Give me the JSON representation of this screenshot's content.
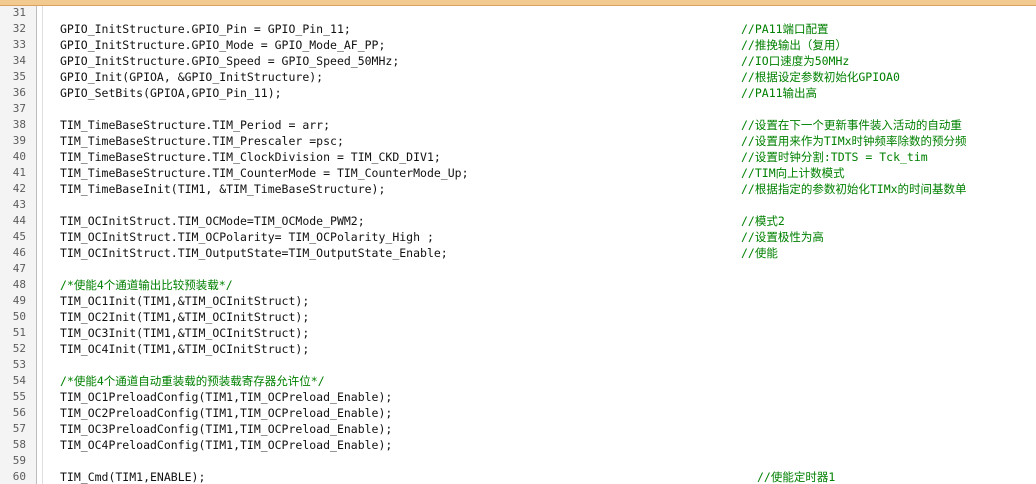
{
  "editor": {
    "lines": [
      {
        "num": "31",
        "code": "",
        "comment": ""
      },
      {
        "num": "32",
        "code": "GPIO_InitStructure.GPIO_Pin = GPIO_Pin_11;",
        "comment": "//PA11端口配置"
      },
      {
        "num": "33",
        "code": "GPIO_InitStructure.GPIO_Mode = GPIO_Mode_AF_PP;",
        "comment": "//推挽输出（复用）"
      },
      {
        "num": "34",
        "code": "GPIO_InitStructure.GPIO_Speed = GPIO_Speed_50MHz;",
        "comment": "//IO口速度为50MHz"
      },
      {
        "num": "35",
        "code": "GPIO_Init(GPIOA, &GPIO_InitStructure);",
        "comment": "//根据设定参数初始化GPIOA0"
      },
      {
        "num": "36",
        "code": "GPIO_SetBits(GPIOA,GPIO_Pin_11);",
        "comment": "//PA11输出高"
      },
      {
        "num": "37",
        "code": "",
        "comment": ""
      },
      {
        "num": "38",
        "code": "TIM_TimeBaseStructure.TIM_Period = arr;",
        "comment": "//设置在下一个更新事件装入活动的自动重"
      },
      {
        "num": "39",
        "code": "TIM_TimeBaseStructure.TIM_Prescaler =psc;",
        "comment": "//设置用来作为TIMx时钟频率除数的预分频"
      },
      {
        "num": "40",
        "code": "TIM_TimeBaseStructure.TIM_ClockDivision = TIM_CKD_DIV1;",
        "comment": "//设置时钟分割:TDTS = Tck_tim"
      },
      {
        "num": "41",
        "code": "TIM_TimeBaseStructure.TIM_CounterMode = TIM_CounterMode_Up;",
        "comment": "//TIM向上计数模式"
      },
      {
        "num": "42",
        "code": "TIM_TimeBaseInit(TIM1, &TIM_TimeBaseStructure);",
        "comment": "//根据指定的参数初始化TIMx的时间基数单"
      },
      {
        "num": "43",
        "code": "",
        "comment": ""
      },
      {
        "num": "44",
        "code": "TIM_OCInitStruct.TIM_OCMode=TIM_OCMode_PWM2;",
        "comment": "//模式2"
      },
      {
        "num": "45",
        "code": "TIM_OCInitStruct.TIM_OCPolarity= TIM_OCPolarity_High ;",
        "comment": "//设置极性为高"
      },
      {
        "num": "46",
        "code": "TIM_OCInitStruct.TIM_OutputState=TIM_OutputState_Enable;",
        "comment": "//使能"
      },
      {
        "num": "47",
        "code": "",
        "comment": ""
      },
      {
        "num": "48",
        "code": "/*使能4个通道输出比较预装载*/",
        "comment": ""
      },
      {
        "num": "49",
        "code": "TIM_OC1Init(TIM1,&TIM_OCInitStruct);",
        "comment": ""
      },
      {
        "num": "50",
        "code": "TIM_OC2Init(TIM1,&TIM_OCInitStruct);",
        "comment": ""
      },
      {
        "num": "51",
        "code": "TIM_OC3Init(TIM1,&TIM_OCInitStruct);",
        "comment": ""
      },
      {
        "num": "52",
        "code": "TIM_OC4Init(TIM1,&TIM_OCInitStruct);",
        "comment": ""
      },
      {
        "num": "53",
        "code": "",
        "comment": ""
      },
      {
        "num": "54",
        "code": "/*使能4个通道自动重装载的预装载寄存器允许位*/",
        "comment": ""
      },
      {
        "num": "55",
        "code": "TIM_OC1PreloadConfig(TIM1,TIM_OCPreload_Enable);",
        "comment": ""
      },
      {
        "num": "56",
        "code": "TIM_OC2PreloadConfig(TIM1,TIM_OCPreload_Enable);",
        "comment": ""
      },
      {
        "num": "57",
        "code": "TIM_OC3PreloadConfig(TIM1,TIM_OCPreload_Enable);",
        "comment": ""
      },
      {
        "num": "58",
        "code": "TIM_OC4PreloadConfig(TIM1,TIM_OCPreload_Enable);",
        "comment": ""
      },
      {
        "num": "59",
        "code": "",
        "comment": ""
      },
      {
        "num": "60",
        "code": "TIM_Cmd(TIM1,ENABLE);",
        "comment": "//使能定时器1"
      }
    ]
  }
}
